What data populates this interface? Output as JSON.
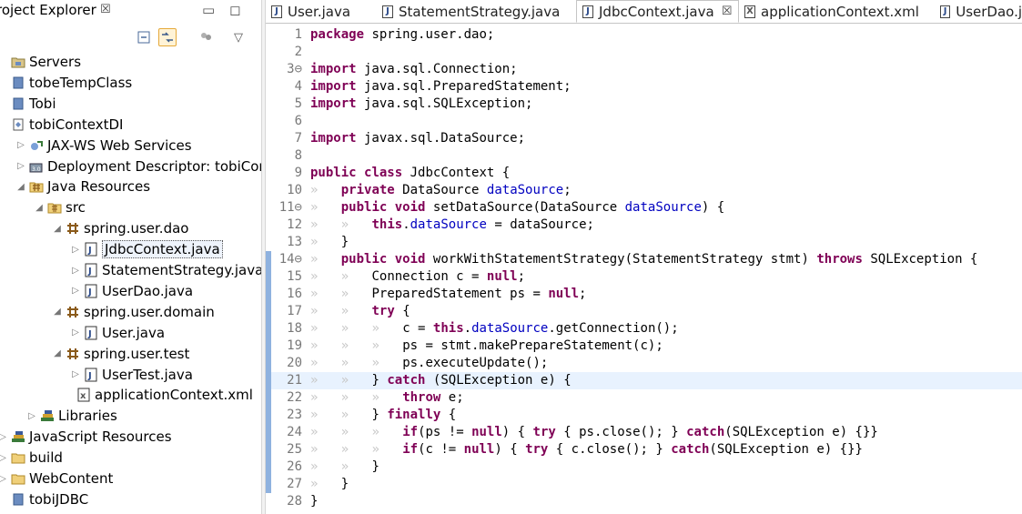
{
  "explorer": {
    "title": "roject Explorer",
    "close_glyph": "☒",
    "minimize_glyph": "▭",
    "maximize_glyph": "◻",
    "menu_glyph": "▽",
    "tree": [
      {
        "label": "Servers",
        "level": 0,
        "twisty": "",
        "icon": "folder-servers-icon"
      },
      {
        "label": "tobeTempClass",
        "level": 0,
        "twisty": "",
        "icon": "project-icon"
      },
      {
        "label": "Tobi",
        "level": 0,
        "twisty": "",
        "icon": "project-icon"
      },
      {
        "label": "tobiContextDI",
        "level": 0,
        "twisty": "",
        "icon": "web-project-icon"
      },
      {
        "label": "JAX-WS Web Services",
        "level": 1,
        "twisty": "▷",
        "icon": "webservice-icon"
      },
      {
        "label": "Deployment Descriptor: tobiConte",
        "level": 1,
        "twisty": "▷",
        "icon": "descriptor-icon"
      },
      {
        "label": "Java Resources",
        "level": 1,
        "twisty": "◢",
        "icon": "java-resources-icon"
      },
      {
        "label": "src",
        "level": 2,
        "twisty": "◢",
        "icon": "source-folder-icon"
      },
      {
        "label": "spring.user.dao",
        "level": 3,
        "twisty": "◢",
        "icon": "package-icon"
      },
      {
        "label": "JdbcContext.java",
        "level": 4,
        "twisty": "▷",
        "icon": "java-file-icon",
        "selected": true
      },
      {
        "label": "StatementStrategy.java",
        "level": 4,
        "twisty": "▷",
        "icon": "java-file-icon"
      },
      {
        "label": "UserDao.java",
        "level": 4,
        "twisty": "▷",
        "icon": "java-file-icon"
      },
      {
        "label": "spring.user.domain",
        "level": 3,
        "twisty": "◢",
        "icon": "package-icon"
      },
      {
        "label": "User.java",
        "level": 4,
        "twisty": "▷",
        "icon": "java-file-icon"
      },
      {
        "label": "spring.user.test",
        "level": 3,
        "twisty": "◢",
        "icon": "package-icon"
      },
      {
        "label": "UserTest.java",
        "level": 4,
        "twisty": "▷",
        "icon": "java-file-icon"
      },
      {
        "label": "applicationContext.xml",
        "level": 3.6,
        "twisty": "",
        "icon": "xml-file-icon"
      },
      {
        "label": "Libraries",
        "level": 1.6,
        "twisty": "▷",
        "icon": "libraries-icon"
      },
      {
        "label": "JavaScript Resources",
        "level": 0,
        "twisty": "▷",
        "icon": "js-resources-icon"
      },
      {
        "label": "build",
        "level": 0,
        "twisty": "▷",
        "icon": "folder-icon"
      },
      {
        "label": "WebContent",
        "level": 0,
        "twisty": "▷",
        "icon": "folder-icon"
      },
      {
        "label": "tobiJDBC",
        "level": 0,
        "twisty": "",
        "icon": "project-icon"
      }
    ]
  },
  "editor": {
    "tabs": [
      {
        "label": "User.java",
        "icon": "java-file-icon",
        "type": "J"
      },
      {
        "label": "StatementStrategy.java",
        "icon": "java-file-icon",
        "type": "J"
      },
      {
        "label": "JdbcContext.java",
        "icon": "java-file-icon",
        "type": "J",
        "active": true,
        "close": "☒"
      },
      {
        "label": "applicationContext.xml",
        "icon": "xml-file-icon",
        "type": "X"
      },
      {
        "label": "UserDao.j",
        "icon": "java-file-icon",
        "type": "J"
      }
    ],
    "lines": [
      {
        "n": "1",
        "code": "package spring.user.dao;"
      },
      {
        "n": "2",
        "code": ""
      },
      {
        "n": "3⊖",
        "code": "import java.sql.Connection;"
      },
      {
        "n": "4",
        "code": "import java.sql.PreparedStatement;"
      },
      {
        "n": "5",
        "code": "import java.sql.SQLException;"
      },
      {
        "n": "6",
        "code": ""
      },
      {
        "n": "7",
        "code": "import javax.sql.DataSource;"
      },
      {
        "n": "8",
        "code": ""
      },
      {
        "n": "9",
        "code": "public class JdbcContext {"
      },
      {
        "n": "10",
        "code": "»   private DataSource dataSource;"
      },
      {
        "n": "11⊖",
        "code": "»   public void setDataSource(DataSource dataSource) {"
      },
      {
        "n": "12",
        "code": "»   »   this.dataSource = dataSource;"
      },
      {
        "n": "13",
        "code": "»   }"
      },
      {
        "n": "14⊖",
        "code": "»   public void workWithStatementStrategy(StatementStrategy stmt) throws SQLException {"
      },
      {
        "n": "15",
        "code": "»   »   Connection c = null;"
      },
      {
        "n": "16",
        "code": "»   »   PreparedStatement ps = null;"
      },
      {
        "n": "17",
        "code": "»   »   try {"
      },
      {
        "n": "18",
        "code": "»   »   »   c = this.dataSource.getConnection();"
      },
      {
        "n": "19",
        "code": "»   »   »   ps = stmt.makePrepareStatement(c);"
      },
      {
        "n": "20",
        "code": "»   »   »   ps.executeUpdate();"
      },
      {
        "n": "21",
        "code": "»   »   } catch (SQLException e) {"
      },
      {
        "n": "22",
        "code": "»   »   »   throw e;"
      },
      {
        "n": "23",
        "code": "»   »   } finally {"
      },
      {
        "n": "24",
        "code": "»   »   »   if(ps != null) { try { ps.close(); } catch(SQLException e) {}}"
      },
      {
        "n": "25",
        "code": "»   »   »   if(c != null) { try { c.close(); } catch(SQLException e) {}}"
      },
      {
        "n": "26",
        "code": "»   »   }"
      },
      {
        "n": "27",
        "code": "»   }"
      },
      {
        "n": "28",
        "code": "}"
      }
    ],
    "highlighted_line": "21"
  },
  "colors": {
    "keyword": "#7f0055",
    "field": "#0000c0",
    "line_highlight": "#e8f2fe",
    "whitespace_marker": "#c8c8c8"
  }
}
